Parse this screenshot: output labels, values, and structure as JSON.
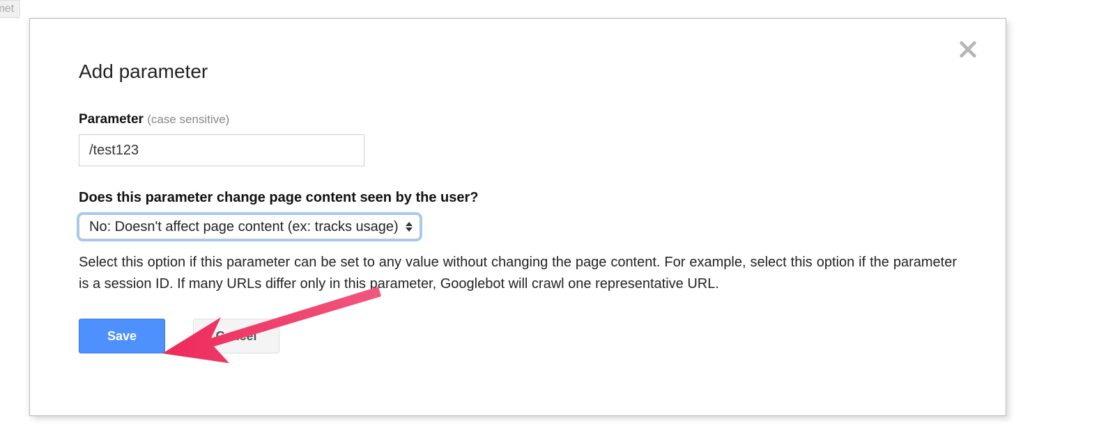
{
  "background": {
    "tab_fragment": "ımet"
  },
  "dialog": {
    "title": "Add parameter",
    "parameter": {
      "label_strong": "Parameter",
      "label_hint": "(case sensitive)",
      "value": "/test123"
    },
    "effect_question": "Does this parameter change page content seen by the user?",
    "effect_select": {
      "selected": "No: Doesn't affect page content (ex: tracks usage)"
    },
    "help_text": "Select this option if this parameter can be set to any value without changing the page content. For example, select this option if the parameter is a session ID. If many URLs differ only in this parameter, Googlebot will crawl one representative URL.",
    "buttons": {
      "save": "Save",
      "cancel": "Cancel"
    }
  }
}
